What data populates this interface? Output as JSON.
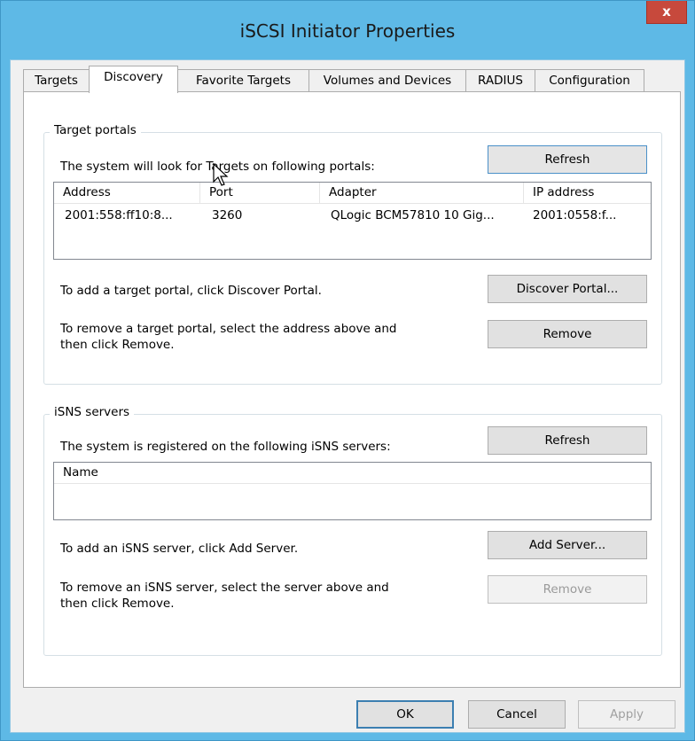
{
  "window": {
    "title": "iSCSI Initiator Properties",
    "close_label": "x"
  },
  "tabs": [
    {
      "label": "Targets"
    },
    {
      "label": "Discovery"
    },
    {
      "label": "Favorite Targets"
    },
    {
      "label": "Volumes and Devices"
    },
    {
      "label": "RADIUS"
    },
    {
      "label": "Configuration"
    }
  ],
  "active_tab": "Discovery",
  "target_portals": {
    "group_title": "Target portals",
    "description": "The system will look for Targets on following portals:",
    "refresh_label": "Refresh",
    "columns": [
      "Address",
      "Port",
      "Adapter",
      "IP address"
    ],
    "rows": [
      [
        "2001:558:ff10:8...",
        "3260",
        "QLogic BCM57810 10 Gig...",
        "2001:0558:f..."
      ]
    ],
    "add_text": "To add a target portal, click Discover Portal.",
    "discover_label": "Discover Portal...",
    "remove_text_line1": "To remove a target portal, select the address above and",
    "remove_text_line2": "then click Remove.",
    "remove_label": "Remove"
  },
  "isns_servers": {
    "group_title": "iSNS servers",
    "description": "The system is registered on the following iSNS servers:",
    "refresh_label": "Refresh",
    "columns": [
      "Name"
    ],
    "add_text": "To add an iSNS server, click Add Server.",
    "add_label": "Add Server...",
    "remove_text_line1": "To remove an iSNS server, select the server above and",
    "remove_text_line2": "then click Remove.",
    "remove_label": "Remove"
  },
  "footer": {
    "ok_label": "OK",
    "cancel_label": "Cancel",
    "apply_label": "Apply"
  },
  "colors": {
    "window_frame": "#5eb9e6",
    "close_button": "#c7493c",
    "panel": "#ffffff"
  }
}
